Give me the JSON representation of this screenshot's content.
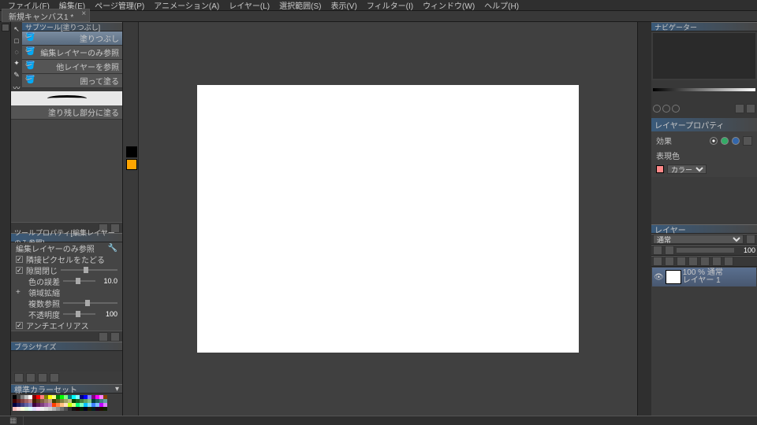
{
  "menu": [
    "ファイル(F)",
    "編集(E)",
    "ページ管理(P)",
    "アニメーション(A)",
    "レイヤー(L)",
    "選択範囲(S)",
    "表示(V)",
    "フィルター(I)",
    "ウィンドウ(W)",
    "ヘルプ(H)"
  ],
  "tab": {
    "label": "新規キャンバス1 *",
    "close": "×"
  },
  "subtool": {
    "header": "サブツール[塗りつぶし]",
    "items": [
      "塗りつぶし",
      "編集レイヤーのみ参照",
      "他レイヤーを参照",
      "囲って塗る",
      "塗り残し部分に塗る"
    ]
  },
  "toolprop": {
    "header": "ツールプロパティ[編集レイヤーのみ参照]",
    "subhead": "編集レイヤーのみ参照",
    "r1": "隣接ピクセルをたどる",
    "r2": "隙間閉じ",
    "r3": "色の誤差",
    "r3v": "10.0",
    "r4": "領域拡縮",
    "r5": "複数参照",
    "r6": "不透明度",
    "r6v": "100",
    "r7": "アンチエイリアス"
  },
  "brushsize": {
    "header": "ブラシサイズ"
  },
  "colorset": {
    "header": "標準カラーセット"
  },
  "navi": {
    "header": "ナビゲーター"
  },
  "layerprop": {
    "header": "レイヤープロパティ",
    "effect": "効果",
    "border": "表現色",
    "combo": "カラー"
  },
  "layers": {
    "header": "レイヤー",
    "mode": "通常",
    "opacity": "100",
    "layer1": {
      "name": "レイヤー 1",
      "kind": "100 % 通常"
    }
  },
  "swatches": [
    "#000000",
    "#404040",
    "#808080",
    "#c0c0c0",
    "#ffffff",
    "#800000",
    "#ff0000",
    "#ff8080",
    "#808000",
    "#ffff00",
    "#ffff80",
    "#008000",
    "#00ff00",
    "#80ff80",
    "#008080",
    "#00ffff",
    "#80ffff",
    "#000080",
    "#0000ff",
    "#8080ff",
    "#800080",
    "#ff00ff",
    "#ff80ff",
    "#804000",
    "#400000",
    "#602020",
    "#804040",
    "#a06060",
    "#c08080",
    "#402000",
    "#604020",
    "#806040",
    "#a08060",
    "#c0a080",
    "#404000",
    "#606020",
    "#808040",
    "#a0a060",
    "#c0c080",
    "#004000",
    "#206020",
    "#408040",
    "#60a060",
    "#80c080",
    "#004040",
    "#206060",
    "#408080",
    "#60a0a0",
    "#000040",
    "#202060",
    "#404080",
    "#6060a0",
    "#8080c0",
    "#400040",
    "#602060",
    "#804080",
    "#a060a0",
    "#c080c0",
    "#ff4000",
    "#ff8040",
    "#ffc080",
    "#ffe0c0",
    "#c0ff00",
    "#e0ff80",
    "#00ff80",
    "#80ffc0",
    "#00c0ff",
    "#80e0ff",
    "#4080ff",
    "#80c0ff",
    "#c000ff",
    "#e080ff",
    "#ffc0c0",
    "#ffe0e0",
    "#ffffe0",
    "#e0ffe0",
    "#e0ffff",
    "#e0e0ff",
    "#ffe0ff",
    "#f0f0f0",
    "#e0e0e0",
    "#d0d0d0",
    "#b0b0b0",
    "#909090",
    "#707070",
    "#505050",
    "#303030",
    "#101010",
    "#200000",
    "#002000",
    "#000020",
    "#202000",
    "#002020",
    "#200020",
    "#201000",
    "#102000"
  ]
}
